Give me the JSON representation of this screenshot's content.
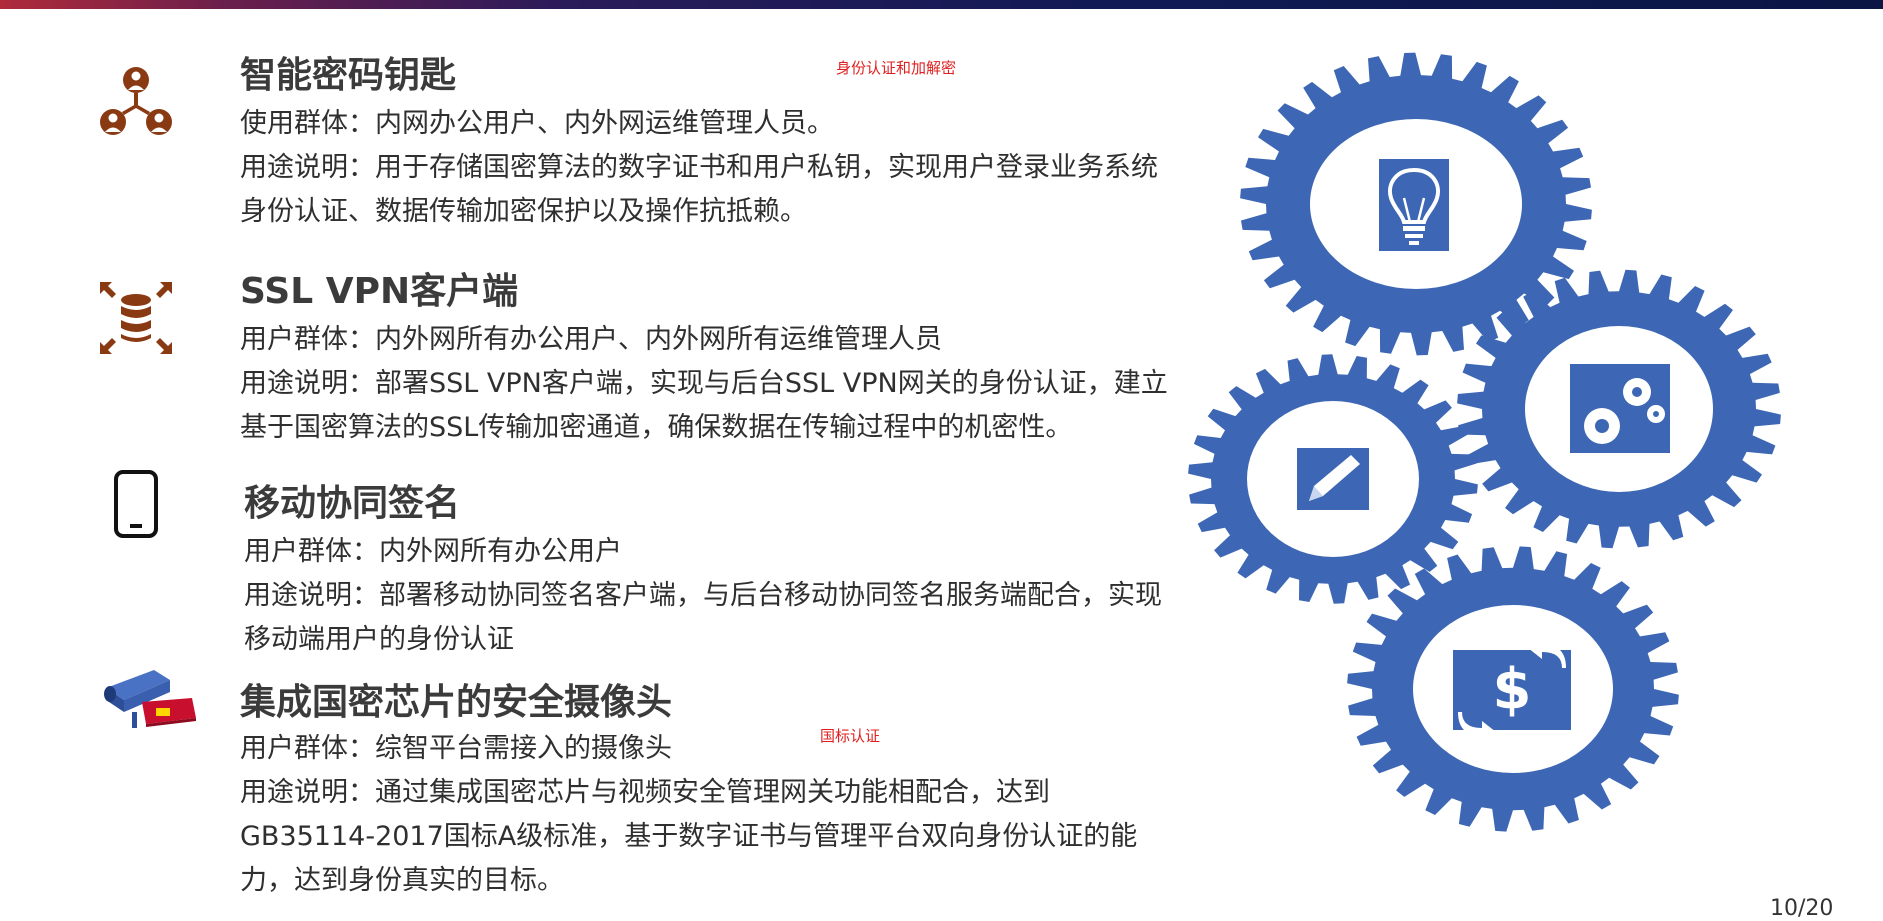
{
  "notes": {
    "auth_encrypt": "身份认证和加解密",
    "national_cert": "国标认证"
  },
  "sections": [
    {
      "icon": "user-hierarchy-icon",
      "title": "智能密码钥匙",
      "line1": "使用群体：内网办公用户、内外网运维管理人员。",
      "line2": "用途说明：用于存储国密算法的数字证书和用户私钥，实现用户登录业务系统身份认证、数据传输加密保护以及操作抗抵赖。"
    },
    {
      "icon": "database-expand-icon",
      "title": "SSL VPN客户端",
      "line1": "用户群体：内外网所有办公用户、内外网所有运维管理人员",
      "line2": "用途说明：部署SSL VPN客户端，实现与后台SSL VPN网关的身份认证，建立基于国密算法的SSL传输加密通道，确保数据在传输过程中的机密性。"
    },
    {
      "icon": "mobile-phone-icon",
      "title": "移动协同签名",
      "line1": "用户群体：内外网所有办公用户",
      "line2": "用途说明：部署移动协同签名客户端，与后台移动协同签名服务端配合，实现移动端用户的身份认证"
    },
    {
      "icon": "security-camera-icon",
      "title": "集成国密芯片的安全摄像头",
      "line1": "用户群体：综智平台需接入的摄像头",
      "line2": "用途说明：通过集成国密芯片与视频安全管理网关功能相配合，达到GB35114-2017国标A级标准，基于数字证书与管理平台双向身份认证的能力，达到身份真实的目标。"
    }
  ],
  "gear_icons": [
    "lightbulb-icon",
    "settings-gears-icon",
    "pencil-icon",
    "dollar-exchange-icon"
  ],
  "colors": {
    "gear": "#3d67b4",
    "icon_brown": "#8a3a12",
    "note_red": "#e02020"
  },
  "page_number": "10/20"
}
